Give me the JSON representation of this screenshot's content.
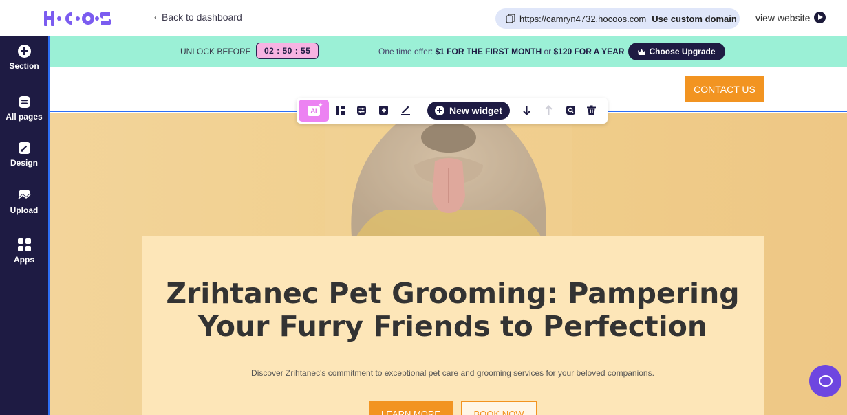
{
  "topbar": {
    "back_label": "Back to dashboard",
    "domain_url": "https://camryn4732.hocoos.com",
    "custom_domain_label": "Use custom domain",
    "view_website_label": "view website"
  },
  "sidebar": {
    "items": [
      {
        "label": "Section",
        "icon": "plus-circle-icon"
      },
      {
        "label": "All pages",
        "icon": "pages-icon"
      },
      {
        "label": "Design",
        "icon": "brush-icon"
      },
      {
        "label": "Upload",
        "icon": "upload-image-icon"
      },
      {
        "label": "Apps",
        "icon": "apps-grid-icon"
      }
    ]
  },
  "promo": {
    "unlock_label": "UNLOCK BEFORE",
    "timer": "02 : 50 : 55",
    "offer_prefix": "One time offer: ",
    "offer_month": "$1 FOR THE FIRST MONTH",
    "offer_or": " or ",
    "offer_year": "$120 FOR A YEAR",
    "upgrade_label": "Choose Upgrade"
  },
  "site_header": {
    "contact_label": "CONTACT US"
  },
  "toolbar": {
    "ai_label": "AI",
    "new_widget_label": "New widget"
  },
  "hero": {
    "title": "Zrihtanec Pet Grooming: Pampering Your Furry Friends to Perfection",
    "subtitle": "Discover Zrihtanec's commitment to exceptional pet care and grooming services for your beloved companions.",
    "learn_more_label": "LEARN MORE",
    "book_now_label": "BOOK NOW"
  },
  "colors": {
    "brand_dark": "#1e1b43",
    "promo_bg": "#9bf0d6",
    "accent_orange": "#f29421",
    "logo_purple": "#7b5cf0",
    "chat_purple": "#6e46e0",
    "selection_blue": "#2d6ef5"
  }
}
